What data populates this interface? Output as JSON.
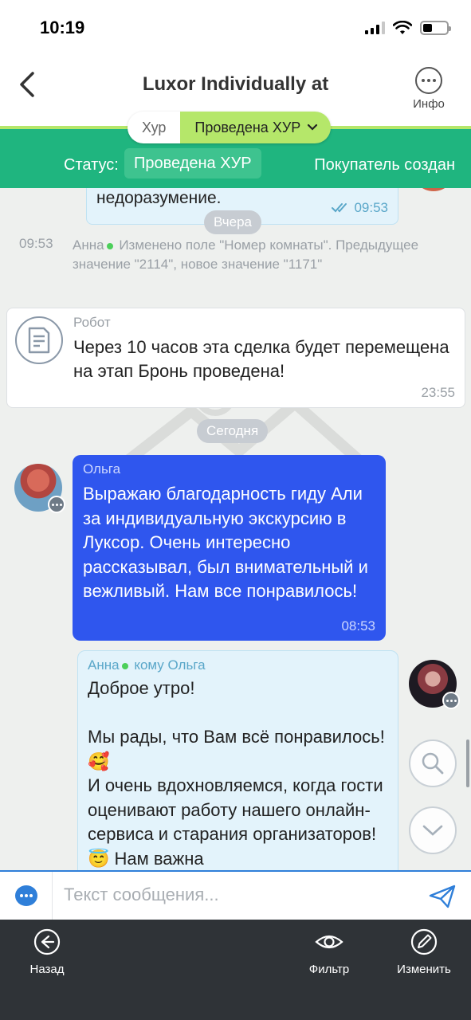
{
  "status_bar": {
    "time": "10:19"
  },
  "header": {
    "title": "Luxor Individually at",
    "info_label": "Инфо"
  },
  "stage": {
    "previous": "Хур",
    "current": "Проведена ХУР",
    "status_label": "Статус:",
    "status_value": "Проведена ХУР",
    "right_text": "Покупатель создан"
  },
  "messages": {
    "top_bubble": {
      "text": "недоразумение.",
      "time": "09:53"
    },
    "date_yesterday": "Вчера",
    "system": {
      "time": "09:53",
      "author": "Анна",
      "text": "Изменено поле \"Номер комнаты\". Предыдущее значение \"2114\", новое значение \"1171\""
    },
    "robot": {
      "name": "Робот",
      "text": "Через 10 часов эта сделка будет перемещена на этап Бронь проведена!",
      "time": "23:55"
    },
    "date_today": "Сегодня",
    "olga": {
      "name": "Ольга",
      "text": "Выражаю благодарность гиду Али за индивидуальную экскурсию в Луксор. Очень интересно рассказывал, был внимательный и вежливый. Нам все понравилось!",
      "time": "08:53"
    },
    "anna": {
      "author": "Анна",
      "to": "кому Ольга",
      "text": "Доброе утро!\n\nМы рады, что Вам всё понравилось! 🥰\nИ очень вдохновляемся, когда гости оценивают работу нашего онлайн-сервиса и старания организаторов! 😇 Нам важна"
    }
  },
  "composer": {
    "placeholder": "Текст сообщения..."
  },
  "toolbar": {
    "back": "Назад",
    "filter": "Фильтр",
    "edit": "Изменить"
  },
  "colors": {
    "accent_green": "#1fb57f",
    "stage_lime": "#b5e76a",
    "incoming_blue": "#2f56ee",
    "outgoing_bubble": "#e3f3fb",
    "toolbar_dark": "#2f3337"
  }
}
